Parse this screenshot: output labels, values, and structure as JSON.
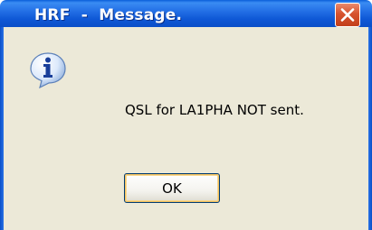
{
  "window": {
    "title": "HRF  -  Message.",
    "close_icon": "close-icon"
  },
  "dialog": {
    "icon": "info-icon",
    "message": "QSL for LA1PHA NOT sent.",
    "ok_label": "OK"
  },
  "colors": {
    "titlebar": "#0a5fd8",
    "close_button": "#d7532e",
    "client_background": "#ece9d8",
    "button_border": "#003c74"
  }
}
